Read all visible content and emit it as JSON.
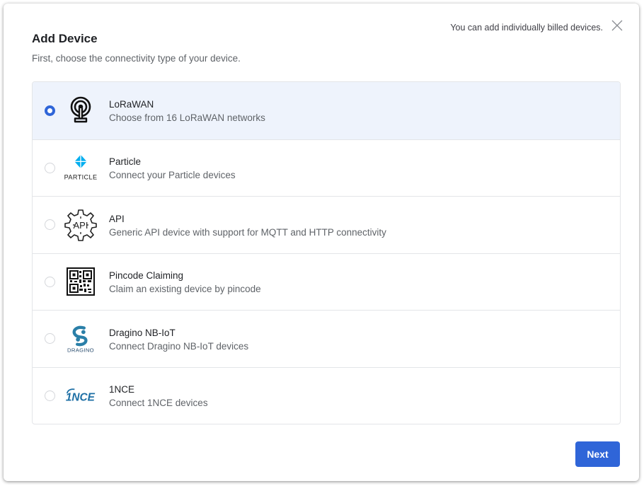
{
  "dialog": {
    "title": "Add Device",
    "subtitle": "First, choose the connectivity type of your device.",
    "hint": "You can add individually billed devices.",
    "close_icon": "close-icon",
    "next_label": "Next",
    "accent_color": "#2f65d8"
  },
  "options": [
    {
      "title": "LoRaWAN",
      "description": "Choose from 16 LoRaWAN networks",
      "icon": "antenna-icon",
      "selected": true
    },
    {
      "title": "Particle",
      "description": "Connect your Particle devices",
      "icon": "particle-logo",
      "logo_text": "PARTICLE",
      "selected": false
    },
    {
      "title": "API",
      "description": "Generic API device with support for MQTT and HTTP connectivity",
      "icon": "api-gear-icon",
      "logo_text": "API",
      "selected": false
    },
    {
      "title": "Pincode Claiming",
      "description": "Claim an existing device by pincode",
      "icon": "qr-code-icon",
      "selected": false
    },
    {
      "title": "Dragino NB-IoT",
      "description": "Connect Dragino NB-IoT devices",
      "icon": "dragino-logo",
      "logo_text": "DRAGINO",
      "selected": false
    },
    {
      "title": "1NCE",
      "description": "Connect 1NCE devices",
      "icon": "1nce-logo",
      "logo_text": "1NCE",
      "selected": false
    }
  ]
}
